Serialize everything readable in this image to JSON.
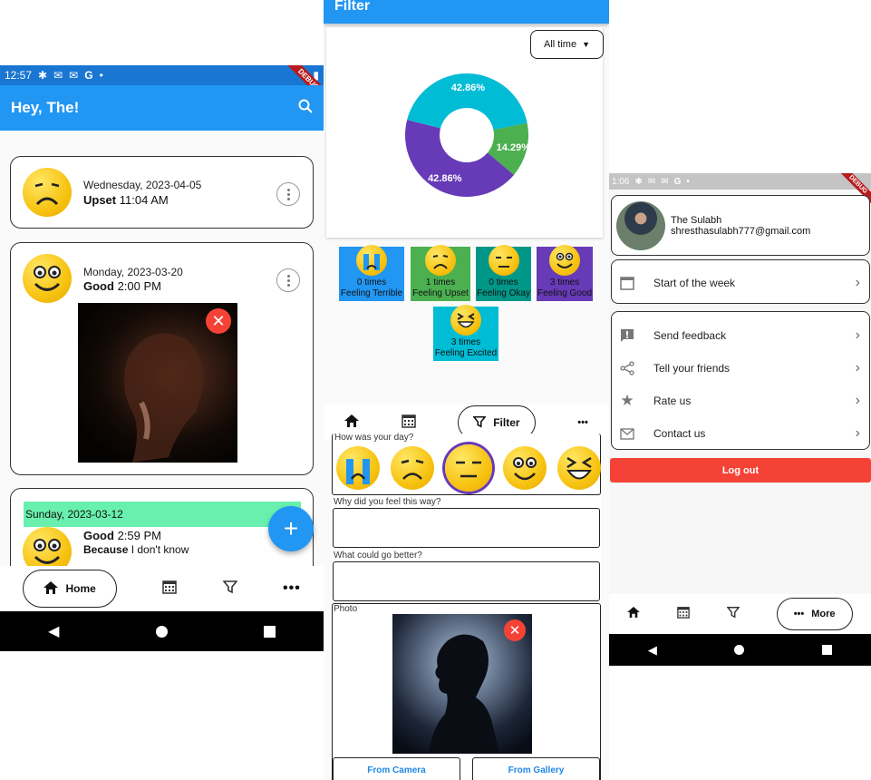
{
  "left": {
    "status_time": "12:57",
    "debug_banner": "DEBUG",
    "title": "Hey, The!",
    "entries": [
      {
        "date": "Wednesday, 2023-04-05",
        "mood": "Upset",
        "time": "11:04 AM"
      },
      {
        "date": "Monday, 2023-03-20",
        "mood": "Good",
        "time": "2:00 PM"
      },
      {
        "date": "Sunday, 2023-03-12",
        "mood": "Good",
        "time": "2:59 PM",
        "because_label": "Because",
        "reason": "I don't know"
      }
    ],
    "nav_home_label": "Home"
  },
  "middle": {
    "title": "Filter",
    "dropdown_value": "All time",
    "chart_data": {
      "type": "pie",
      "style": "donut",
      "slices": [
        {
          "label": "42.86%",
          "value": 42.86,
          "color": "#00bcd4"
        },
        {
          "label": "14.29%",
          "value": 14.29,
          "color": "#4caf50"
        },
        {
          "label": "42.86%",
          "value": 42.86,
          "color": "#673ab7"
        }
      ]
    },
    "tiles": [
      {
        "count": "0 times",
        "label": "Feeling Terrible",
        "color": "#2196f3"
      },
      {
        "count": "1 times",
        "label": "Feeling Upset",
        "color": "#4caf50"
      },
      {
        "count": "0 times",
        "label": "Feeling Okay",
        "color": "#009688"
      },
      {
        "count": "3 times",
        "label": "Feeling Good",
        "color": "#673ab7"
      },
      {
        "count": "3 times",
        "label": "Feeling Excited",
        "color": "#00bcd4"
      }
    ],
    "nav_filter_label": "Filter",
    "q1": "How was your day?",
    "q2": "Why did you feel this way?",
    "q3": "What could go better?",
    "photo_label": "Photo",
    "from_camera": "From Camera",
    "from_gallery": "From Gallery"
  },
  "right": {
    "status_time": "1:06",
    "debug_banner": "DEBUG",
    "user_name": "The Sulabh",
    "user_email": "shresthasulabh777@gmail.com",
    "start_week": "Start of the week",
    "send_feedback": "Send feedback",
    "tell_friends": "Tell your friends",
    "rate_us": "Rate us",
    "contact_us": "Contact us",
    "logout": "Log out",
    "nav_more_label": "More"
  },
  "colors": {
    "primary": "#2196f3",
    "danger": "#f44336",
    "highlight": "#69f0ae"
  }
}
